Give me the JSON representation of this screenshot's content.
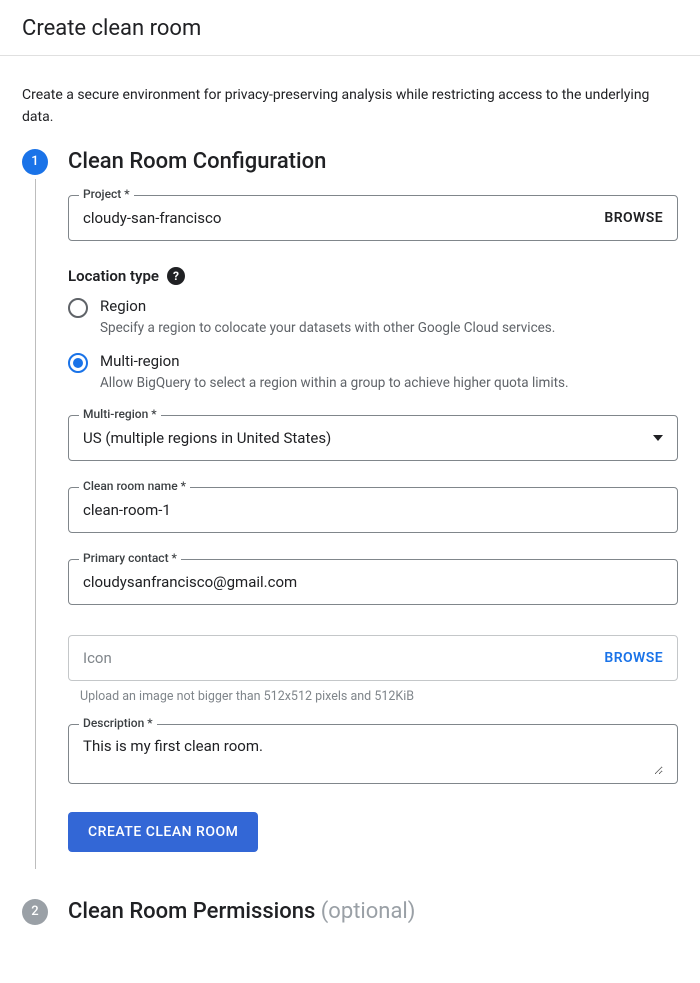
{
  "header": {
    "title": "Create clean room"
  },
  "intro": "Create a secure environment for privacy-preserving analysis while restricting access to the underlying data.",
  "step1": {
    "badge": "1",
    "title": "Clean Room Configuration",
    "project_label": "Project *",
    "project_value": "cloudy-san-francisco",
    "browse_label": "BROWSE",
    "location_type_label": "Location type",
    "radio_region_title": "Region",
    "radio_region_desc": "Specify a region to colocate your datasets with other Google Cloud services.",
    "radio_multi_title": "Multi-region",
    "radio_multi_desc": "Allow BigQuery to select a region within a group to achieve higher quota limits.",
    "multiregion_label": "Multi-region *",
    "multiregion_value": "US (multiple regions in United States)",
    "name_label": "Clean room name *",
    "name_value": "clean-room-1",
    "contact_label": "Primary contact *",
    "contact_value": "cloudysanfrancisco@gmail.com",
    "icon_placeholder": "Icon",
    "icon_browse": "BROWSE",
    "icon_hint": "Upload an image not bigger than 512x512 pixels and 512KiB",
    "desc_label": "Description *",
    "desc_value": "This is my first clean room.",
    "submit": "CREATE CLEAN ROOM"
  },
  "step2": {
    "badge": "2",
    "title": "Clean Room Permissions ",
    "optional": "(optional)"
  }
}
